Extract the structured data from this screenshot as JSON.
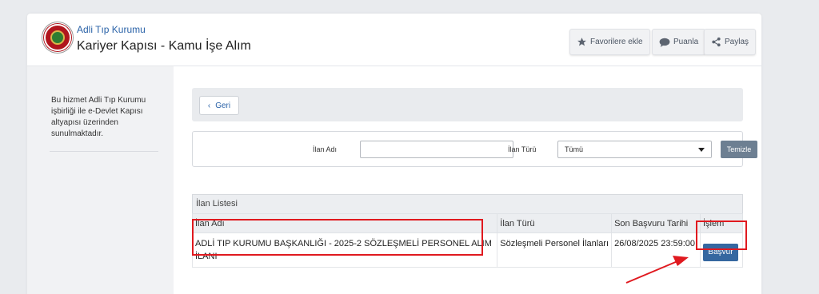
{
  "header": {
    "org_name": "Adli Tıp Kurumu",
    "title": "Kariyer Kapısı - Kamu İşe Alım",
    "buttons": {
      "favorites": "Favorilere ekle",
      "rate": "Puanla",
      "share": "Paylaş"
    }
  },
  "sidebar": {
    "info": "Bu hizmet Adli Tıp Kurumu işbirliği ile e-Devlet Kapısı altyapısı üzerinden sunulmaktadır."
  },
  "main": {
    "back_label": "Geri",
    "filter": {
      "name_label": "İlan Adı",
      "name_value": "",
      "type_label": "İlan Türü",
      "type_value": "Tümü",
      "clear_label": "Temizle"
    },
    "table": {
      "caption": "İlan Listesi",
      "headers": [
        "İlan Adı",
        "İlan Türü",
        "Son Başvuru Tarihi",
        "İşlem"
      ],
      "rows": [
        {
          "name": "ADLİ TIP KURUMU BAŞKANLIĞI - 2025-2 SÖZLEŞMELİ PERSONEL ALIM İLANI",
          "type": "Sözleşmeli Personel İlanları",
          "deadline": "26/08/2025 23:59:00",
          "action": "Başvur"
        }
      ]
    }
  },
  "colors": {
    "accent": "#3567a0",
    "highlight": "#e0191f",
    "link": "#2b63a8"
  }
}
